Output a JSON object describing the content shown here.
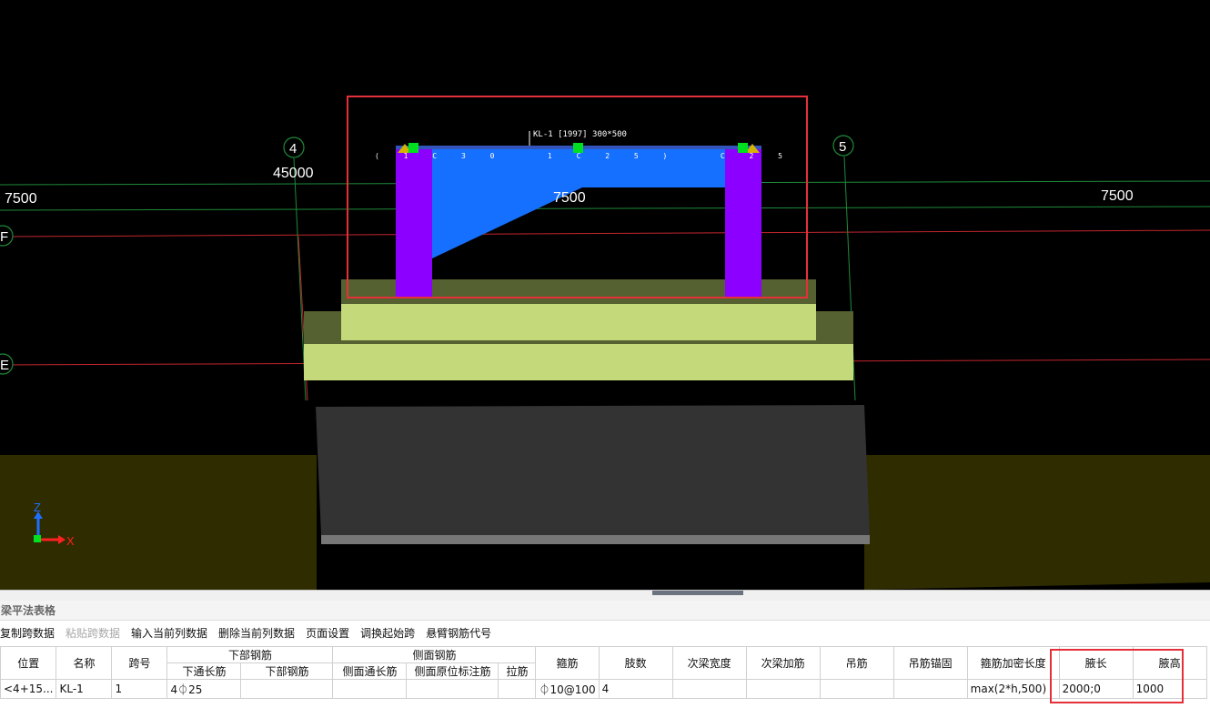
{
  "viewport": {
    "axis_labels": {
      "axis4": "4",
      "axis5": "5",
      "axisF": "F",
      "axisE": "E"
    },
    "dims": {
      "left_span": "7500",
      "total": "45000",
      "mid_span": "7500",
      "right_span": "7500"
    },
    "coord": {
      "z": "Z",
      "x": "X"
    },
    "beam_text": {
      "line1": "KL-1 [1997] 300*500",
      "line2": "(1C30 1C25) C25"
    },
    "colors": {
      "beam": "#1670ff",
      "column": "#8b00ff",
      "slab": "#c4d97a",
      "foundation": "#333333",
      "ground": "#2f2c00",
      "highlight": "#e5303a"
    }
  },
  "panel": {
    "title": "梁平法表格",
    "toolbar": [
      {
        "label": "复制跨数据",
        "enabled": true
      },
      {
        "label": "粘贴跨数据",
        "enabled": false
      },
      {
        "label": "输入当前列数据",
        "enabled": true
      },
      {
        "label": "删除当前列数据",
        "enabled": true
      },
      {
        "label": "页面设置",
        "enabled": true
      },
      {
        "label": "调换起始跨",
        "enabled": true
      },
      {
        "label": "悬臂钢筋代号",
        "enabled": true
      }
    ],
    "headers": {
      "position": "位置",
      "name": "名称",
      "span": "跨号",
      "bottom_group": "下部钢筋",
      "bottom_through": "下通长筋",
      "bottom_rebar": "下部钢筋",
      "side_group": "侧面钢筋",
      "side_through": "侧面通长筋",
      "side_in_situ": "侧面原位标注筋",
      "tie": "拉筋",
      "stirrup": "箍筋",
      "legs": "肢数",
      "sec_width": "次梁宽度",
      "sec_add": "次梁加筋",
      "hanger": "吊筋",
      "hanger_anchor": "吊筋锚固",
      "dense_len": "箍筋加密长度",
      "haunch_len": "腋长",
      "haunch_h": "腋高"
    },
    "row": {
      "position": "<4+15...",
      "name": "KL-1",
      "span": "1",
      "bottom_through": "4⏀25",
      "bottom_rebar": "",
      "side_through": "",
      "side_in_situ": "",
      "tie": "",
      "stirrup": "⏀10@100",
      "legs": "4",
      "sec_width": "",
      "sec_add": "",
      "hanger": "",
      "hanger_anchor": "",
      "dense_len": "max(2*h,500)",
      "haunch_len": "2000;0",
      "haunch_h": "1000"
    }
  }
}
